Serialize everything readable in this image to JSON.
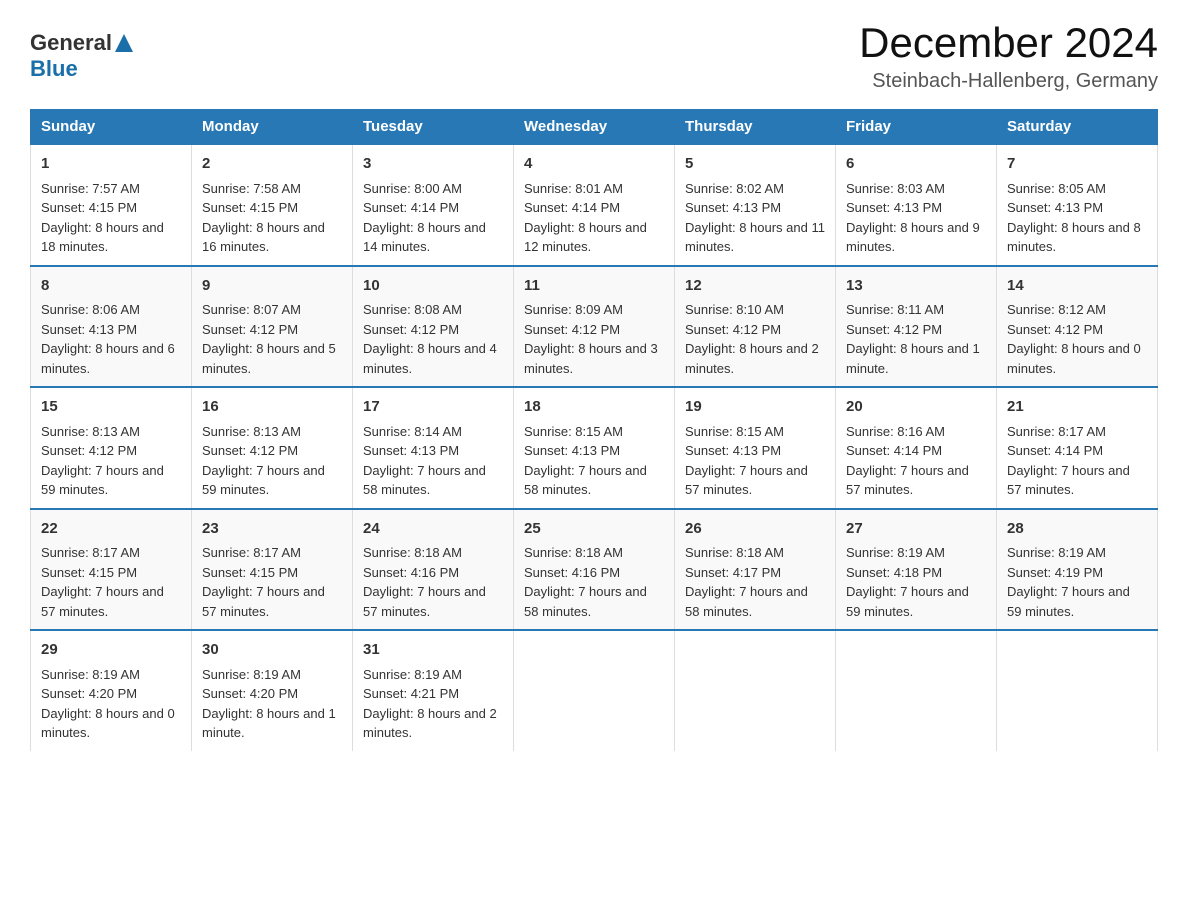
{
  "header": {
    "logo_general": "General",
    "logo_blue": "Blue",
    "month_title": "December 2024",
    "location": "Steinbach-Hallenberg, Germany"
  },
  "days_of_week": [
    "Sunday",
    "Monday",
    "Tuesday",
    "Wednesday",
    "Thursday",
    "Friday",
    "Saturday"
  ],
  "weeks": [
    [
      {
        "day": "1",
        "sunrise": "7:57 AM",
        "sunset": "4:15 PM",
        "daylight": "8 hours and 18 minutes."
      },
      {
        "day": "2",
        "sunrise": "7:58 AM",
        "sunset": "4:15 PM",
        "daylight": "8 hours and 16 minutes."
      },
      {
        "day": "3",
        "sunrise": "8:00 AM",
        "sunset": "4:14 PM",
        "daylight": "8 hours and 14 minutes."
      },
      {
        "day": "4",
        "sunrise": "8:01 AM",
        "sunset": "4:14 PM",
        "daylight": "8 hours and 12 minutes."
      },
      {
        "day": "5",
        "sunrise": "8:02 AM",
        "sunset": "4:13 PM",
        "daylight": "8 hours and 11 minutes."
      },
      {
        "day": "6",
        "sunrise": "8:03 AM",
        "sunset": "4:13 PM",
        "daylight": "8 hours and 9 minutes."
      },
      {
        "day": "7",
        "sunrise": "8:05 AM",
        "sunset": "4:13 PM",
        "daylight": "8 hours and 8 minutes."
      }
    ],
    [
      {
        "day": "8",
        "sunrise": "8:06 AM",
        "sunset": "4:13 PM",
        "daylight": "8 hours and 6 minutes."
      },
      {
        "day": "9",
        "sunrise": "8:07 AM",
        "sunset": "4:12 PM",
        "daylight": "8 hours and 5 minutes."
      },
      {
        "day": "10",
        "sunrise": "8:08 AM",
        "sunset": "4:12 PM",
        "daylight": "8 hours and 4 minutes."
      },
      {
        "day": "11",
        "sunrise": "8:09 AM",
        "sunset": "4:12 PM",
        "daylight": "8 hours and 3 minutes."
      },
      {
        "day": "12",
        "sunrise": "8:10 AM",
        "sunset": "4:12 PM",
        "daylight": "8 hours and 2 minutes."
      },
      {
        "day": "13",
        "sunrise": "8:11 AM",
        "sunset": "4:12 PM",
        "daylight": "8 hours and 1 minute."
      },
      {
        "day": "14",
        "sunrise": "8:12 AM",
        "sunset": "4:12 PM",
        "daylight": "8 hours and 0 minutes."
      }
    ],
    [
      {
        "day": "15",
        "sunrise": "8:13 AM",
        "sunset": "4:12 PM",
        "daylight": "7 hours and 59 minutes."
      },
      {
        "day": "16",
        "sunrise": "8:13 AM",
        "sunset": "4:12 PM",
        "daylight": "7 hours and 59 minutes."
      },
      {
        "day": "17",
        "sunrise": "8:14 AM",
        "sunset": "4:13 PM",
        "daylight": "7 hours and 58 minutes."
      },
      {
        "day": "18",
        "sunrise": "8:15 AM",
        "sunset": "4:13 PM",
        "daylight": "7 hours and 58 minutes."
      },
      {
        "day": "19",
        "sunrise": "8:15 AM",
        "sunset": "4:13 PM",
        "daylight": "7 hours and 57 minutes."
      },
      {
        "day": "20",
        "sunrise": "8:16 AM",
        "sunset": "4:14 PM",
        "daylight": "7 hours and 57 minutes."
      },
      {
        "day": "21",
        "sunrise": "8:17 AM",
        "sunset": "4:14 PM",
        "daylight": "7 hours and 57 minutes."
      }
    ],
    [
      {
        "day": "22",
        "sunrise": "8:17 AM",
        "sunset": "4:15 PM",
        "daylight": "7 hours and 57 minutes."
      },
      {
        "day": "23",
        "sunrise": "8:17 AM",
        "sunset": "4:15 PM",
        "daylight": "7 hours and 57 minutes."
      },
      {
        "day": "24",
        "sunrise": "8:18 AM",
        "sunset": "4:16 PM",
        "daylight": "7 hours and 57 minutes."
      },
      {
        "day": "25",
        "sunrise": "8:18 AM",
        "sunset": "4:16 PM",
        "daylight": "7 hours and 58 minutes."
      },
      {
        "day": "26",
        "sunrise": "8:18 AM",
        "sunset": "4:17 PM",
        "daylight": "7 hours and 58 minutes."
      },
      {
        "day": "27",
        "sunrise": "8:19 AM",
        "sunset": "4:18 PM",
        "daylight": "7 hours and 59 minutes."
      },
      {
        "day": "28",
        "sunrise": "8:19 AM",
        "sunset": "4:19 PM",
        "daylight": "7 hours and 59 minutes."
      }
    ],
    [
      {
        "day": "29",
        "sunrise": "8:19 AM",
        "sunset": "4:20 PM",
        "daylight": "8 hours and 0 minutes."
      },
      {
        "day": "30",
        "sunrise": "8:19 AM",
        "sunset": "4:20 PM",
        "daylight": "8 hours and 1 minute."
      },
      {
        "day": "31",
        "sunrise": "8:19 AM",
        "sunset": "4:21 PM",
        "daylight": "8 hours and 2 minutes."
      },
      null,
      null,
      null,
      null
    ]
  ]
}
